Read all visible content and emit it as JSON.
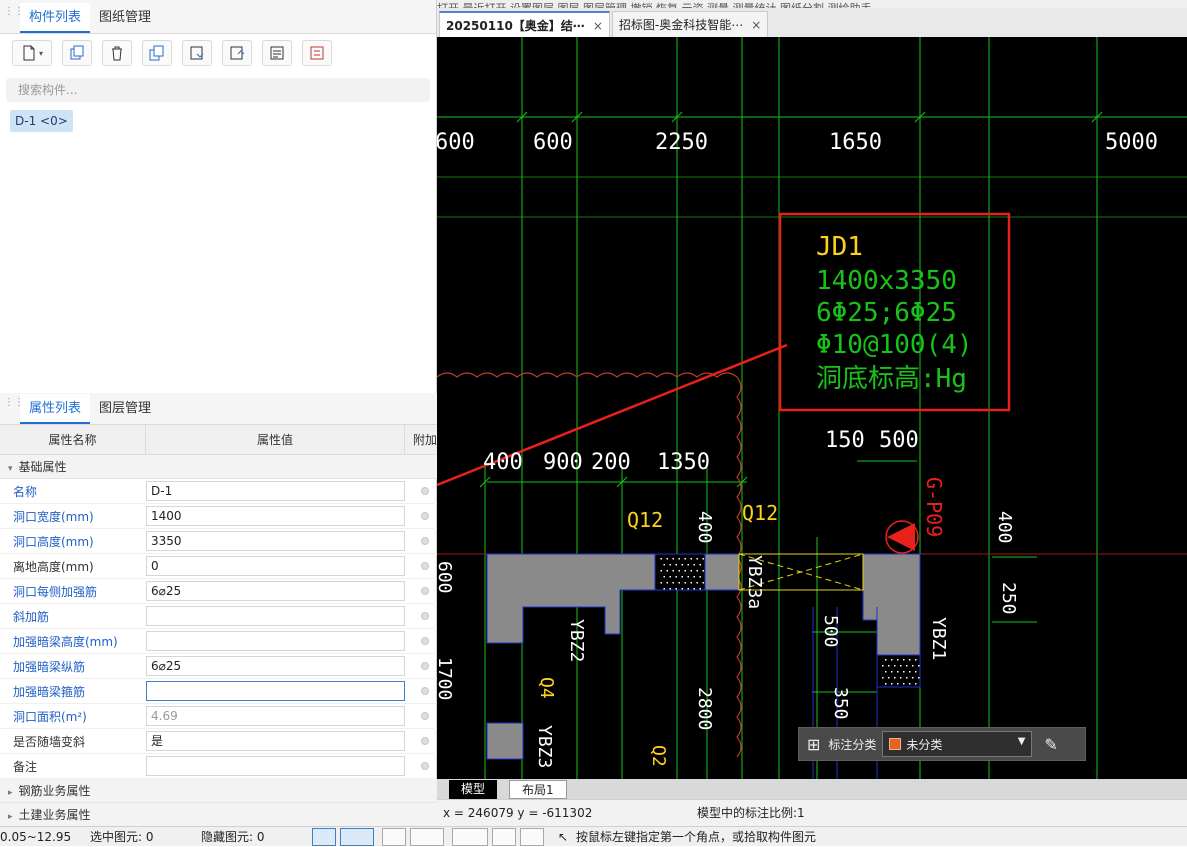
{
  "component_panel": {
    "tabs": [
      "构件列表",
      "图纸管理"
    ],
    "search_placeholder": "搜索构件...",
    "component": "D-1 <0>"
  },
  "property_panel": {
    "tabs": [
      "属性列表",
      "图层管理"
    ],
    "headers": [
      "属性名称",
      "属性值",
      "附加"
    ],
    "section_basic": "基础属性",
    "rows": [
      {
        "name": "名称",
        "value": "D-1",
        "blue": true
      },
      {
        "name": "洞口宽度(mm)",
        "value": "1400",
        "blue": true
      },
      {
        "name": "洞口高度(mm)",
        "value": "3350",
        "blue": true
      },
      {
        "name": "离地高度(mm)",
        "value": "0",
        "blue": false
      },
      {
        "name": "洞口每侧加强筋",
        "value": "6⌀25",
        "blue": true
      },
      {
        "name": "斜加筋",
        "value": "",
        "blue": true
      },
      {
        "name": "加强暗梁高度(mm)",
        "value": "",
        "blue": true
      },
      {
        "name": "加强暗梁纵筋",
        "value": "6⌀25",
        "blue": true
      },
      {
        "name": "加强暗梁箍筋",
        "value": "",
        "blue": true
      },
      {
        "name": "洞口面积(m²)",
        "value": "4.69",
        "blue": true
      },
      {
        "name": "是否随墙变斜",
        "value": "是",
        "blue": false
      },
      {
        "name": "备注",
        "value": "",
        "blue": false
      }
    ],
    "section_rebar": "钢筋业务属性",
    "section_civil": "土建业务属性"
  },
  "doc_tabs": [
    {
      "label": "20250110【奥金】结⋯",
      "close": "×"
    },
    {
      "label": "招标图-奥金科技智能⋯",
      "close": "×"
    }
  ],
  "cad": {
    "dims_top": [
      "600",
      "600",
      "2250",
      "1650",
      "5000"
    ],
    "dims_mid": [
      "400",
      "900",
      "200",
      "1350"
    ],
    "dims_right": [
      "150",
      "500"
    ],
    "label_box": [
      "JD1",
      "1400x3350",
      "6Φ25;6Φ25",
      "Φ10@100(4)",
      "洞底标高:Hg"
    ],
    "labels": {
      "q12a": "Q12",
      "q12b": "Q12",
      "yb23a": "YBZ3a",
      "ybz2": "YBZ2",
      "ybz1": "YBZ1",
      "ybz3": "YBZ3",
      "q4": "Q4",
      "q2": "Q2",
      "gp09": "G-P09",
      "d400a": "400",
      "d400b": "400",
      "d250": "250",
      "d500": "500",
      "d350": "350",
      "d600": "600",
      "d1700": "1700",
      "d2800": "2800"
    }
  },
  "annot_panel": {
    "label": "标注分类",
    "value": "未分类",
    "color": "#e4651d"
  },
  "layout_tabs": [
    "模型",
    "布局1"
  ],
  "coord_bar": {
    "coords": "x = 246079  y = -611302",
    "scale": "模型中的标注比例:1"
  },
  "status_bar": {
    "range": "0.05~12.95",
    "selected": "选中图元: 0",
    "hidden": "隐藏图元: 0",
    "hint": "按鼠标左键指定第一个角点，或拾取构件图元"
  },
  "top_menu_fragment": "打开  最近打开  设置图层  图层  图层管理  撤销  恢复  云资  测量  测量统计  图纸分割  测绘助手"
}
